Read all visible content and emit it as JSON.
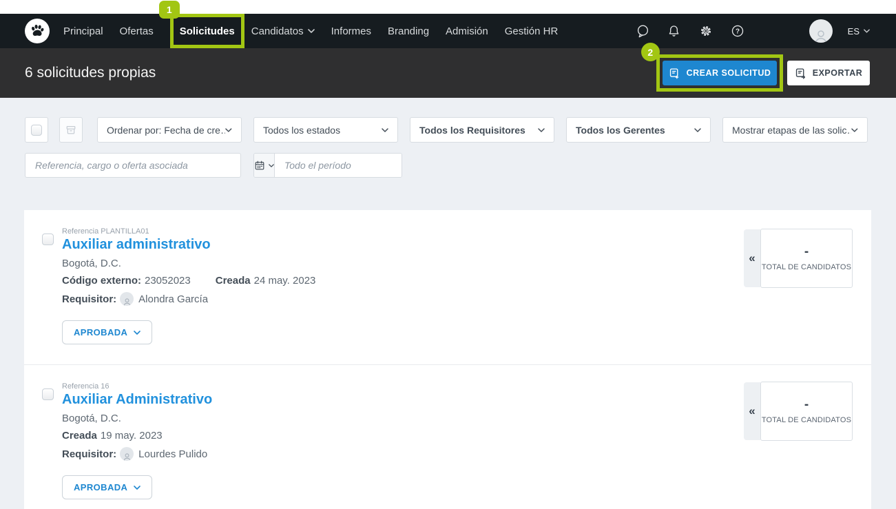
{
  "annotations": {
    "step1": "1",
    "step2": "2",
    "highlight_color": "#a2c613"
  },
  "nav": {
    "items": [
      {
        "label": "Principal"
      },
      {
        "label": "Ofertas"
      },
      {
        "label": "Solicitudes",
        "active": true
      },
      {
        "label": "Candidatos",
        "has_dropdown": true
      },
      {
        "label": "Informes"
      },
      {
        "label": "Branding"
      },
      {
        "label": "Admisión"
      },
      {
        "label": "Gestión HR"
      }
    ],
    "language": "ES"
  },
  "header": {
    "title": "6 solicitudes propias",
    "create_button": "CREAR SOLICITUD",
    "export_button": "EXPORTAR"
  },
  "filters": {
    "sort_by": "Ordenar por: Fecha de cre…",
    "states": "Todos los estados",
    "requisitors": "Todos los Requisitores",
    "managers": "Todos los Gerentes",
    "stages": "Mostrar etapas de las solic…",
    "search_placeholder": "Referencia, cargo o oferta asociada",
    "period_placeholder": "Todo el período"
  },
  "requests": [
    {
      "reference_label": "Referencia",
      "reference": "PLANTILLA01",
      "title": "Auxiliar administrativo",
      "location": "Bogotá, D.C.",
      "external_code_label": "Código externo:",
      "external_code": "23052023",
      "created_label": "Creada",
      "created_date": "24 may. 2023",
      "requisitor_label": "Requisitor:",
      "requisitor": "Alondra García",
      "status": "APROBADA",
      "candidates_total": "-",
      "candidates_label": "TOTAL DE CANDIDATOS"
    },
    {
      "reference_label": "Referencia",
      "reference": "16",
      "title": "Auxiliar Administrativo",
      "location": "Bogotá, D.C.",
      "created_label": "Creada",
      "created_date": "19 may. 2023",
      "requisitor_label": "Requisitor:",
      "requisitor": "Lourdes Pulido",
      "status": "APROBADA",
      "candidates_total": "-",
      "candidates_label": "TOTAL DE CANDIDATOS"
    }
  ],
  "icons": {
    "collapse": "«",
    "colors": {
      "nav_background": "#161c20",
      "subheader_background": "#2f2f30",
      "page_background": "#edf0f4",
      "accent_blue": "#1e87d0",
      "link_blue": "#2191dd"
    }
  }
}
